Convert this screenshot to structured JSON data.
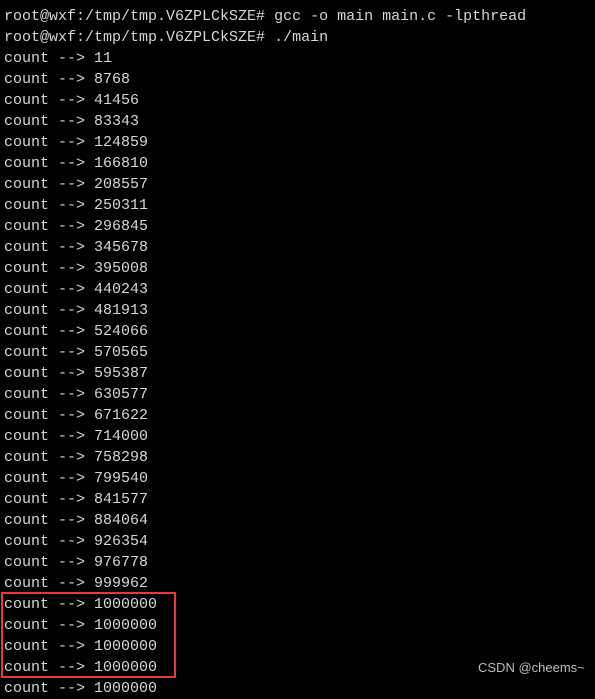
{
  "terminal": {
    "prompt": "root@wxf:/tmp/tmp.V6ZPLCkSZE#",
    "commands": [
      "gcc -o main main.c -lpthread",
      "./main"
    ],
    "output_prefix": "count --> ",
    "values": [
      "11",
      "8768",
      "41456",
      "83343",
      "124859",
      "166810",
      "208557",
      "250311",
      "296845",
      "345678",
      "395008",
      "440243",
      "481913",
      "524066",
      "570565",
      "595387",
      "630577",
      "671622",
      "714000",
      "758298",
      "799540",
      "841577",
      "884064",
      "926354",
      "976778",
      "999962",
      "1000000",
      "1000000",
      "1000000",
      "1000000",
      "1000000"
    ]
  },
  "highlight": {
    "color": "#e8383b"
  },
  "watermark": "CSDN @cheems~"
}
